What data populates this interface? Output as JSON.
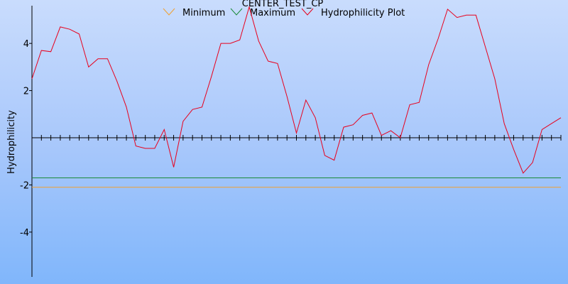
{
  "chart_data": {
    "type": "line",
    "title": "CENTER_TEST_CP",
    "xlabel": "",
    "ylabel": "Hydrophilicity",
    "ylim": [
      -5.9,
      5.6
    ],
    "xlim": [
      0,
      56
    ],
    "yticks": [
      -4,
      -2,
      2,
      4
    ],
    "x_tick_count": 57,
    "grid": false,
    "legend_position": "top",
    "series": [
      {
        "name": "Minimum",
        "color": "#f0a030",
        "style": "horizontal",
        "x": [
          0,
          56
        ],
        "y": [
          -2.1,
          -2.1
        ]
      },
      {
        "name": "Maximum",
        "color": "#1a8a3a",
        "style": "horizontal",
        "x": [
          0,
          56
        ],
        "y": [
          -1.7,
          -1.7
        ]
      },
      {
        "name": "Hydrophilicity Plot",
        "color": "#e8001c",
        "x": [
          0,
          1,
          2,
          3,
          4,
          5,
          6,
          7,
          8,
          9,
          10,
          11,
          12,
          13,
          14,
          15,
          16,
          17,
          18,
          19,
          20,
          21,
          22,
          23,
          24,
          25,
          26,
          27,
          28,
          29,
          30,
          31,
          32,
          33,
          34,
          35,
          36,
          37,
          38,
          39,
          40,
          41,
          42,
          43,
          44,
          45,
          46,
          47,
          48,
          49,
          50,
          51,
          52,
          53,
          54,
          55,
          56
        ],
        "y": [
          2.5,
          3.7,
          3.65,
          4.7,
          4.6,
          4.4,
          3.0,
          3.35,
          3.35,
          2.4,
          1.3,
          -0.35,
          -0.45,
          -0.45,
          0.35,
          -1.25,
          0.7,
          1.2,
          1.3,
          2.6,
          4.0,
          4.0,
          4.15,
          5.55,
          4.1,
          3.25,
          3.15,
          1.75,
          0.2,
          1.6,
          0.85,
          -0.75,
          -0.95,
          0.45,
          0.55,
          0.95,
          1.05,
          0.1,
          0.3,
          0.0,
          1.4,
          1.5,
          3.1,
          4.2,
          5.45,
          5.1,
          5.2,
          5.2,
          3.85,
          2.5,
          0.6,
          -0.5,
          -1.5,
          -1.05,
          0.35,
          0.6,
          0.85
        ]
      }
    ]
  }
}
